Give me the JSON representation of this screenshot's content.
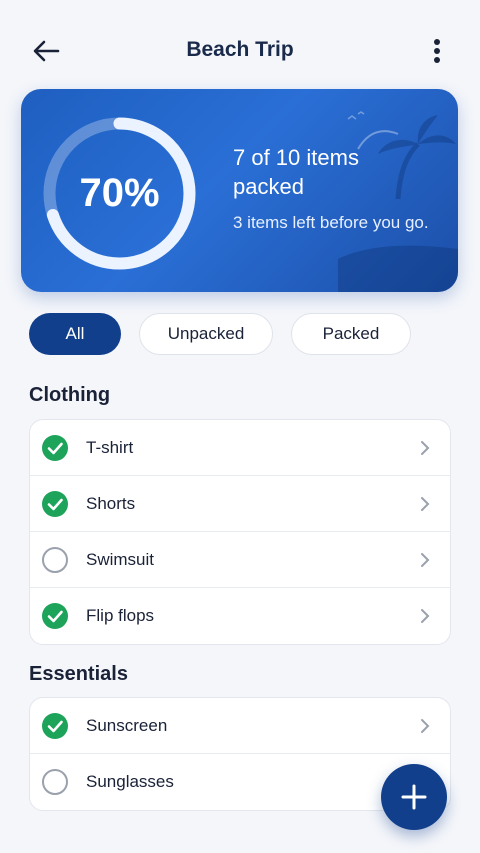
{
  "header": {
    "title": "Beach Trip",
    "back_icon": "arrow-left-icon",
    "more_icon": "more-vertical-icon"
  },
  "progress": {
    "percent_label": "70%",
    "fraction": 0.7,
    "headline": "7 of 10 items packed",
    "subtext": "3 items left before you go."
  },
  "filters": [
    {
      "label": "All",
      "active": true
    },
    {
      "label": "Unpacked",
      "active": false
    },
    {
      "label": "Packed",
      "active": false
    }
  ],
  "sections": [
    {
      "title": "Clothing",
      "items": [
        {
          "label": "T-shirt",
          "packed": true
        },
        {
          "label": "Shorts",
          "packed": true
        },
        {
          "label": "Swimsuit",
          "packed": false
        },
        {
          "label": "Flip flops",
          "packed": true
        }
      ]
    },
    {
      "title": "Essentials",
      "items": [
        {
          "label": "Sunscreen",
          "packed": true
        },
        {
          "label": "Sunglasses",
          "packed": false
        }
      ]
    }
  ],
  "fab": {
    "icon": "plus-icon"
  },
  "colors": {
    "accent": "#123f8c",
    "card": "#2a6fd6",
    "check": "#1ea35a"
  }
}
